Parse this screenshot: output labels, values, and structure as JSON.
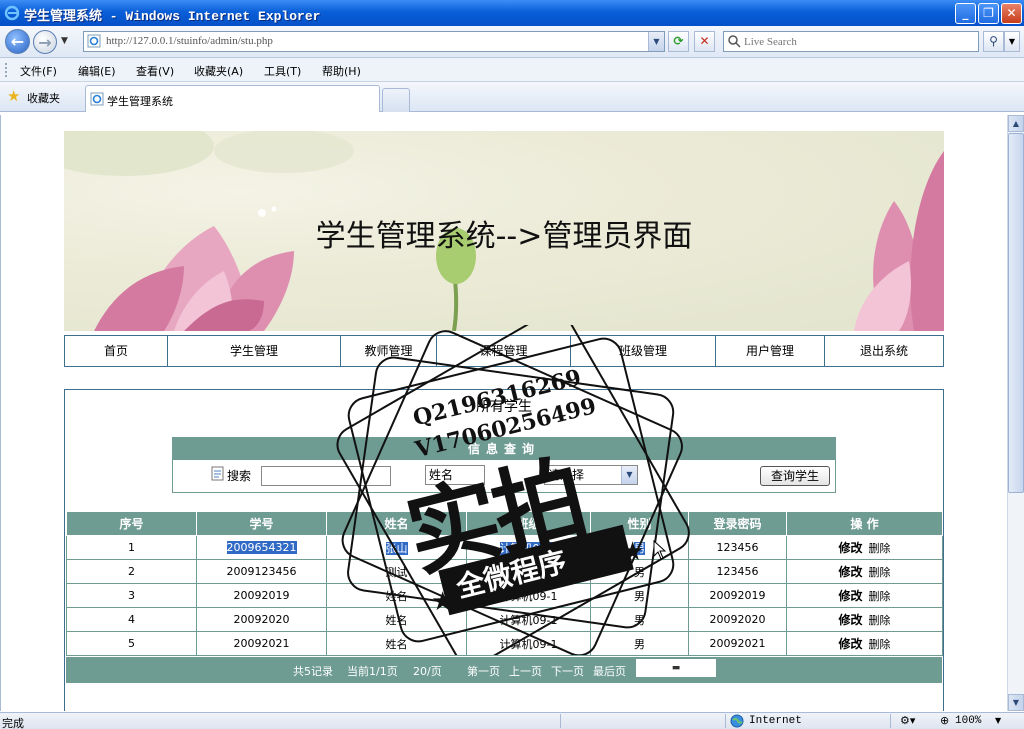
{
  "window": {
    "title": "学生管理系统 - Windows Internet Explorer"
  },
  "address_bar": {
    "url": "http://127.0.0.1/stuinfo/admin/stu.php",
    "search_placeholder": "Live Search"
  },
  "menu": {
    "items": [
      "文件(F)",
      "编辑(E)",
      "查看(V)",
      "收藏夹(A)",
      "工具(T)",
      "帮助(H)"
    ]
  },
  "favorites": {
    "label": "收藏夹"
  },
  "tab": {
    "label": "学生管理系统"
  },
  "banner": {
    "title": "学生管理系统-->管理员界面"
  },
  "nav": {
    "items": [
      "首页",
      "学生管理",
      "教师管理",
      "课程管理",
      "班级管理",
      "用户管理",
      "退出系统"
    ]
  },
  "content": {
    "title": "所有学生"
  },
  "search": {
    "header": "信息查询",
    "label": "搜索",
    "field_select": "姓名",
    "class_select": "请选择",
    "button": "查询学生"
  },
  "table": {
    "headers": [
      "序号",
      "学号",
      "姓名",
      "班级",
      "性别",
      "登录密码",
      "操 作"
    ],
    "rows": [
      [
        "1",
        "2009654321",
        "张山",
        "计算机09-3",
        "男",
        "123456"
      ],
      [
        "2",
        "2009123456",
        "测试",
        "计算机09-3",
        "男",
        "123456"
      ],
      [
        "3",
        "20092019",
        "姓名",
        "计算机09-1",
        "男",
        "20092019"
      ],
      [
        "4",
        "20092020",
        "姓名",
        "计算机09-1",
        "男",
        "20092020"
      ],
      [
        "5",
        "20092021",
        "姓名",
        "计算机09-1",
        "男",
        "20092021"
      ]
    ],
    "edit_label": "修改",
    "delete_label": "删除"
  },
  "pager": {
    "total": "共5记录",
    "current": "当前1/1页",
    "per_page": "20/页",
    "first": "第一页",
    "prev": "上一页",
    "next": "下一页",
    "last": "最后页"
  },
  "watermark": {
    "line1": "Q2196316269",
    "line2": "V17060256499",
    "big": "实拍",
    "small": "全微程序"
  },
  "status": {
    "text": "完成",
    "zone": "Internet",
    "zoom": "100%"
  },
  "colors": {
    "table_header": "#6e9b92",
    "nav_border": "#3f6f8f",
    "title_bar": "#0a5fd8"
  }
}
